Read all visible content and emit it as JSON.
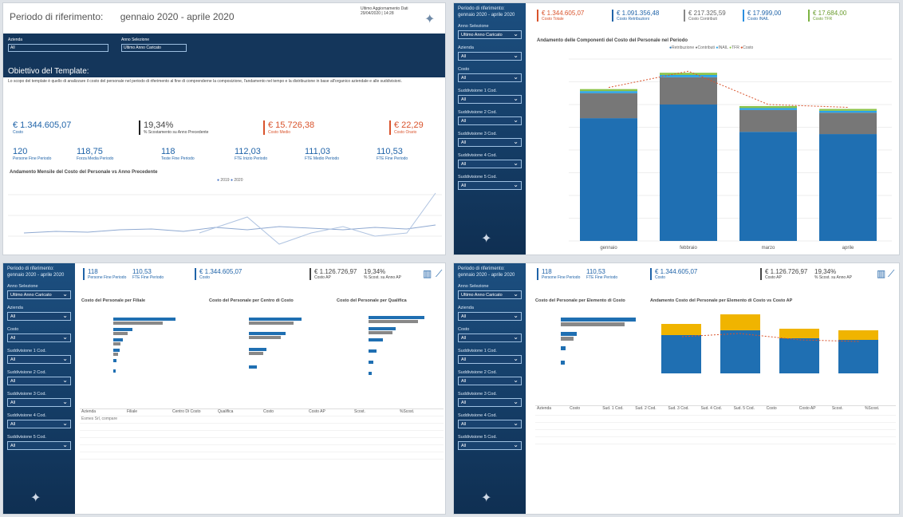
{
  "p1": {
    "title_prefix": "Periodo di riferimento:",
    "period": "gennaio 2020 - aprile 2020",
    "last_update_label": "Ultimo Aggiornamento Dati",
    "last_update": "29/04/2020 | 14:28",
    "filters": [
      {
        "label": "Azienda",
        "value": "All"
      },
      {
        "label": "Anno Selezione",
        "value": "Ultimo Anno Caricato"
      }
    ],
    "objective_title": "Obiettivo del Template:",
    "objective_text": "Lo scopo del template è quello di analizzare il costo del personale nel periodo di riferimento al fine di comprenderne la composizione, l'andamento nel tempo e la distribuzione in base all'organico aziendale e alle suddivisioni.",
    "kpis": [
      {
        "v": "€ 1.344.605,07",
        "s": "Costo"
      },
      {
        "v": "19,34%",
        "s": "% Scostamento su Anno Precedente"
      },
      {
        "v": "€ 15.726,38",
        "s": "Costo Medio"
      },
      {
        "v": "€ 22,29",
        "s": "Costo Orario"
      }
    ],
    "kpis2": [
      {
        "v": "120",
        "s": "Persone Fine Periodo"
      },
      {
        "v": "118,75",
        "s": "Forza Media Periodo"
      },
      {
        "v": "118",
        "s": "Teste Fine Periodo"
      },
      {
        "v": "112,03",
        "s": "FTE Inizio Periodo"
      },
      {
        "v": "111,03",
        "s": "FTE Medio Periodo"
      },
      {
        "v": "110,53",
        "s": "FTE Fine Periodo"
      }
    ],
    "chart_title": "Andamento Mensile del Costo del Personale vs Anno Precedente",
    "legend": [
      "2019",
      "2020"
    ]
  },
  "p2": {
    "kpis": [
      {
        "v": "€ 1.344.605,07",
        "s": "Costo Totale"
      },
      {
        "v": "€ 1.091.356,48",
        "s": "Costo Retribuzioni"
      },
      {
        "v": "€ 217.325,59",
        "s": "Costo Contributi"
      },
      {
        "v": "€ 17.999,00",
        "s": "Costo INAIL"
      },
      {
        "v": "€ 17.684,00",
        "s": "Costo TFR"
      }
    ],
    "chart_title": "Andamento delle Componenti del Costo del Personale nel Periodo",
    "legend": [
      "Retribuzione",
      "Contributi",
      "INAIL",
      "TFR",
      "Costo"
    ],
    "nav_labels": [
      "Periodo di riferimento:",
      "gennaio 2020 - aprile 2020",
      "Anno Selezione",
      "Azienda",
      "Costo",
      "Suddivisione 1 Cod.",
      "Suddivisione 2 Cod.",
      "Suddivisione 3 Cod.",
      "Suddivisione 4 Cod.",
      "Suddivisione 5 Cod."
    ]
  },
  "p3": {
    "kpis": [
      {
        "v": "118",
        "s": "Persone Fine Periodo"
      },
      {
        "v": "110,53",
        "s": "FTE Fine Periodo"
      },
      {
        "v": "€ 1.344.605,07",
        "s": "Costo"
      },
      {
        "v": "€ 1.126.726,97",
        "s": "Costo AP"
      },
      {
        "v": "19,34%",
        "s": "% Scost. su Anno AP"
      }
    ],
    "charts": [
      "Costo del Personale per Filiale",
      "Costo del Personale per Centro di Costo",
      "Costo del Personale per Qualifica"
    ],
    "table_headers": [
      "Azienda",
      "Filiale",
      "Centro Di Costo",
      "Qualifica",
      "Costo",
      "Costo AP",
      "Scost.",
      "%Scost."
    ],
    "company": "Esmes Srl, compare"
  },
  "p4": {
    "kpis": [
      {
        "v": "118",
        "s": "Persone Fine Periodo"
      },
      {
        "v": "110,53",
        "s": "FTE Fine Periodo"
      },
      {
        "v": "€ 1.344.605,07",
        "s": "Costo"
      },
      {
        "v": "€ 1.126.726,97",
        "s": "Costo AP"
      },
      {
        "v": "19,34%",
        "s": "% Scost. su Anno AP"
      }
    ],
    "chart_left": "Costo del Personale per Elemento di Costo",
    "chart_right": "Andamento Costo del Personale per Elemento di Costo vs Costo AP",
    "table_headers": [
      "Azienda",
      "Costo",
      "Sud. 1 Cod.",
      "Sud. 2 Cod.",
      "Sud. 3 Cod.",
      "Sud. 4 Cod.",
      "Sud. 5 Cod.",
      "Costo",
      "Costo AP",
      "Scost.",
      "%Scost."
    ]
  },
  "chart_data": {
    "type": "bar",
    "categories": [
      "gennaio",
      "febbraio",
      "marzo",
      "aprile"
    ],
    "series": [
      {
        "name": "Retribuzione",
        "values": [
          270000,
          300000,
          240000,
          235000
        ]
      },
      {
        "name": "Contributi",
        "values": [
          55000,
          60000,
          48000,
          47000
        ]
      },
      {
        "name": "INAIL",
        "values": [
          4500,
          5000,
          4300,
          4200
        ]
      },
      {
        "name": "TFR",
        "values": [
          4400,
          4800,
          4300,
          4100
        ]
      }
    ],
    "ylim": [
      0,
      400000
    ]
  }
}
